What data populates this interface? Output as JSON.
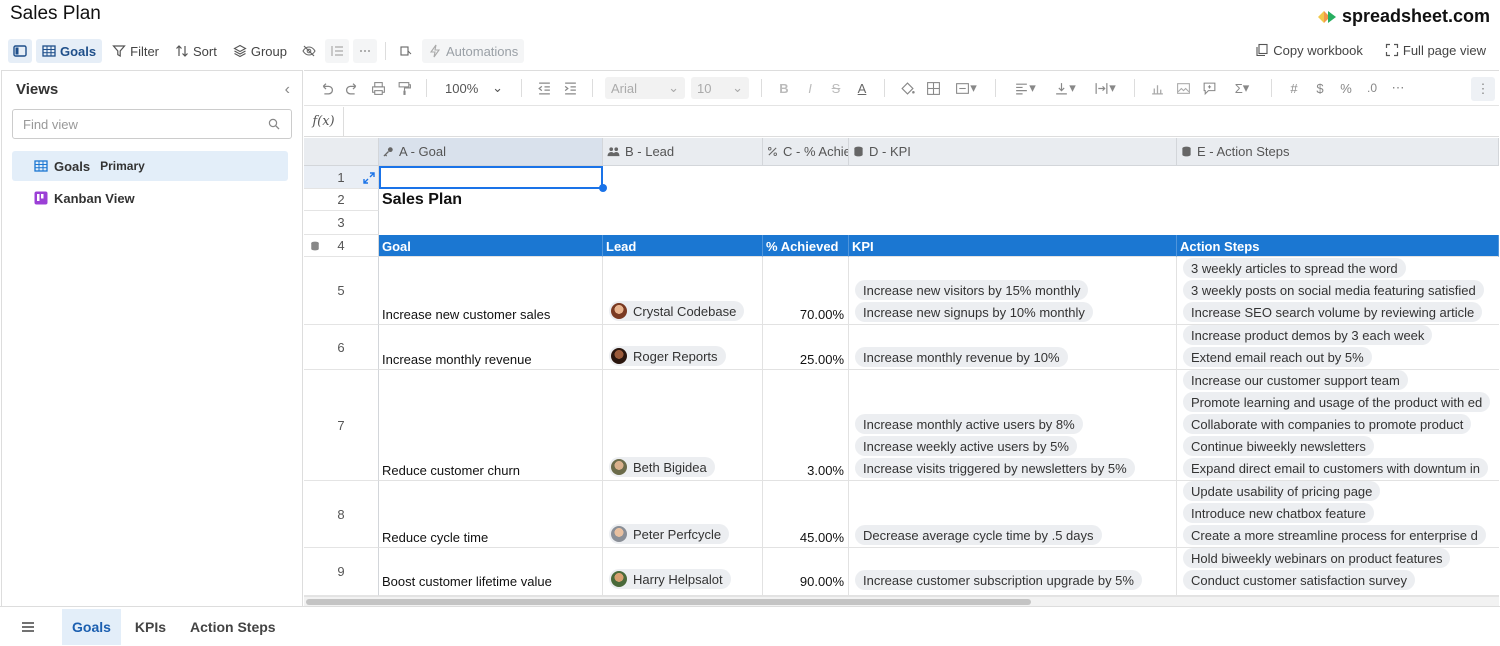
{
  "document": {
    "title": "Sales Plan"
  },
  "brand": {
    "name": "spreadsheet.com",
    "colors": [
      "#f2c94c",
      "#f2994a",
      "#27ae60"
    ]
  },
  "toolbar": {
    "goals_label": "Goals",
    "filter_label": "Filter",
    "sort_label": "Sort",
    "group_label": "Group",
    "automations_label": "Automations",
    "copy_workbook_label": "Copy workbook",
    "full_page_view_label": "Full page view"
  },
  "views": {
    "title": "Views",
    "find_placeholder": "Find view",
    "items": [
      {
        "label": "Goals",
        "badge": "Primary",
        "icon": "grid-icon"
      },
      {
        "label": "Kanban View",
        "badge": "",
        "icon": "kanban-icon"
      }
    ]
  },
  "format_bar": {
    "zoom": "100%",
    "font": "Arial",
    "font_size": "10"
  },
  "columns": [
    {
      "label": "A - Goal",
      "icon": "key-icon"
    },
    {
      "label": "B - Lead",
      "icon": "people-icon"
    },
    {
      "label": "C - % Achie",
      "icon": "percent-icon"
    },
    {
      "label": "D - KPI",
      "icon": "database-icon"
    },
    {
      "label": "E - Action Steps",
      "icon": "database-icon"
    }
  ],
  "row_numbers": [
    "1",
    "2",
    "3",
    "4",
    "5",
    "6",
    "7",
    "8",
    "9"
  ],
  "sheet_title": "Sales Plan",
  "table_headers": [
    "Goal",
    "Lead",
    "% Achieved",
    "KPI",
    "Action Steps"
  ],
  "rows": [
    {
      "goal": "Increase new customer sales",
      "lead": "Crystal Codebase",
      "achieved": "70.00%",
      "kpis": [
        "Increase new visitors by 15% monthly",
        "Increase new signups by 10% monthly"
      ],
      "actions": [
        "3 weekly articles to spread the word",
        "3 weekly posts on social media featuring satisfied",
        "Increase SEO search volume by reviewing article"
      ]
    },
    {
      "goal": "Increase monthly revenue",
      "lead": "Roger Reports",
      "achieved": "25.00%",
      "kpis": [
        "Increase monthly revenue by 10%"
      ],
      "actions": [
        "Increase product demos by 3 each week",
        "Extend email reach out by 5%"
      ]
    },
    {
      "goal": "Reduce customer churn",
      "lead": "Beth Bigidea",
      "achieved": "3.00%",
      "kpis": [
        "Increase monthly active users by 8%",
        "Increase weekly active users by 5%",
        "Increase visits triggered by newsletters by 5%"
      ],
      "actions": [
        "Increase our customer support team",
        "Promote learning and usage of the product with ed",
        "Collaborate with companies to promote product",
        "Continue biweekly newsletters",
        "Expand direct email to customers with downtum in"
      ]
    },
    {
      "goal": "Reduce cycle time",
      "lead": "Peter Perfcycle",
      "achieved": "45.00%",
      "kpis": [
        "Decrease average cycle time by .5 days"
      ],
      "actions": [
        "Update usability of pricing page",
        "Introduce new chatbox feature",
        "Create a more streamline process for enterprise d"
      ]
    },
    {
      "goal": "Boost customer lifetime value",
      "lead": "Harry Helpsalot",
      "achieved": "90.00%",
      "kpis": [
        "Increase customer subscription upgrade by 5%"
      ],
      "actions": [
        "Hold biweekly webinars on product features",
        "Conduct customer satisfaction survey"
      ]
    }
  ],
  "sheet_tabs": [
    "Goals",
    "KPIs",
    "Action Steps"
  ],
  "colors": {
    "accent": "#1b77d2",
    "selection": "#1a73e8",
    "chip": "#eceef1"
  }
}
